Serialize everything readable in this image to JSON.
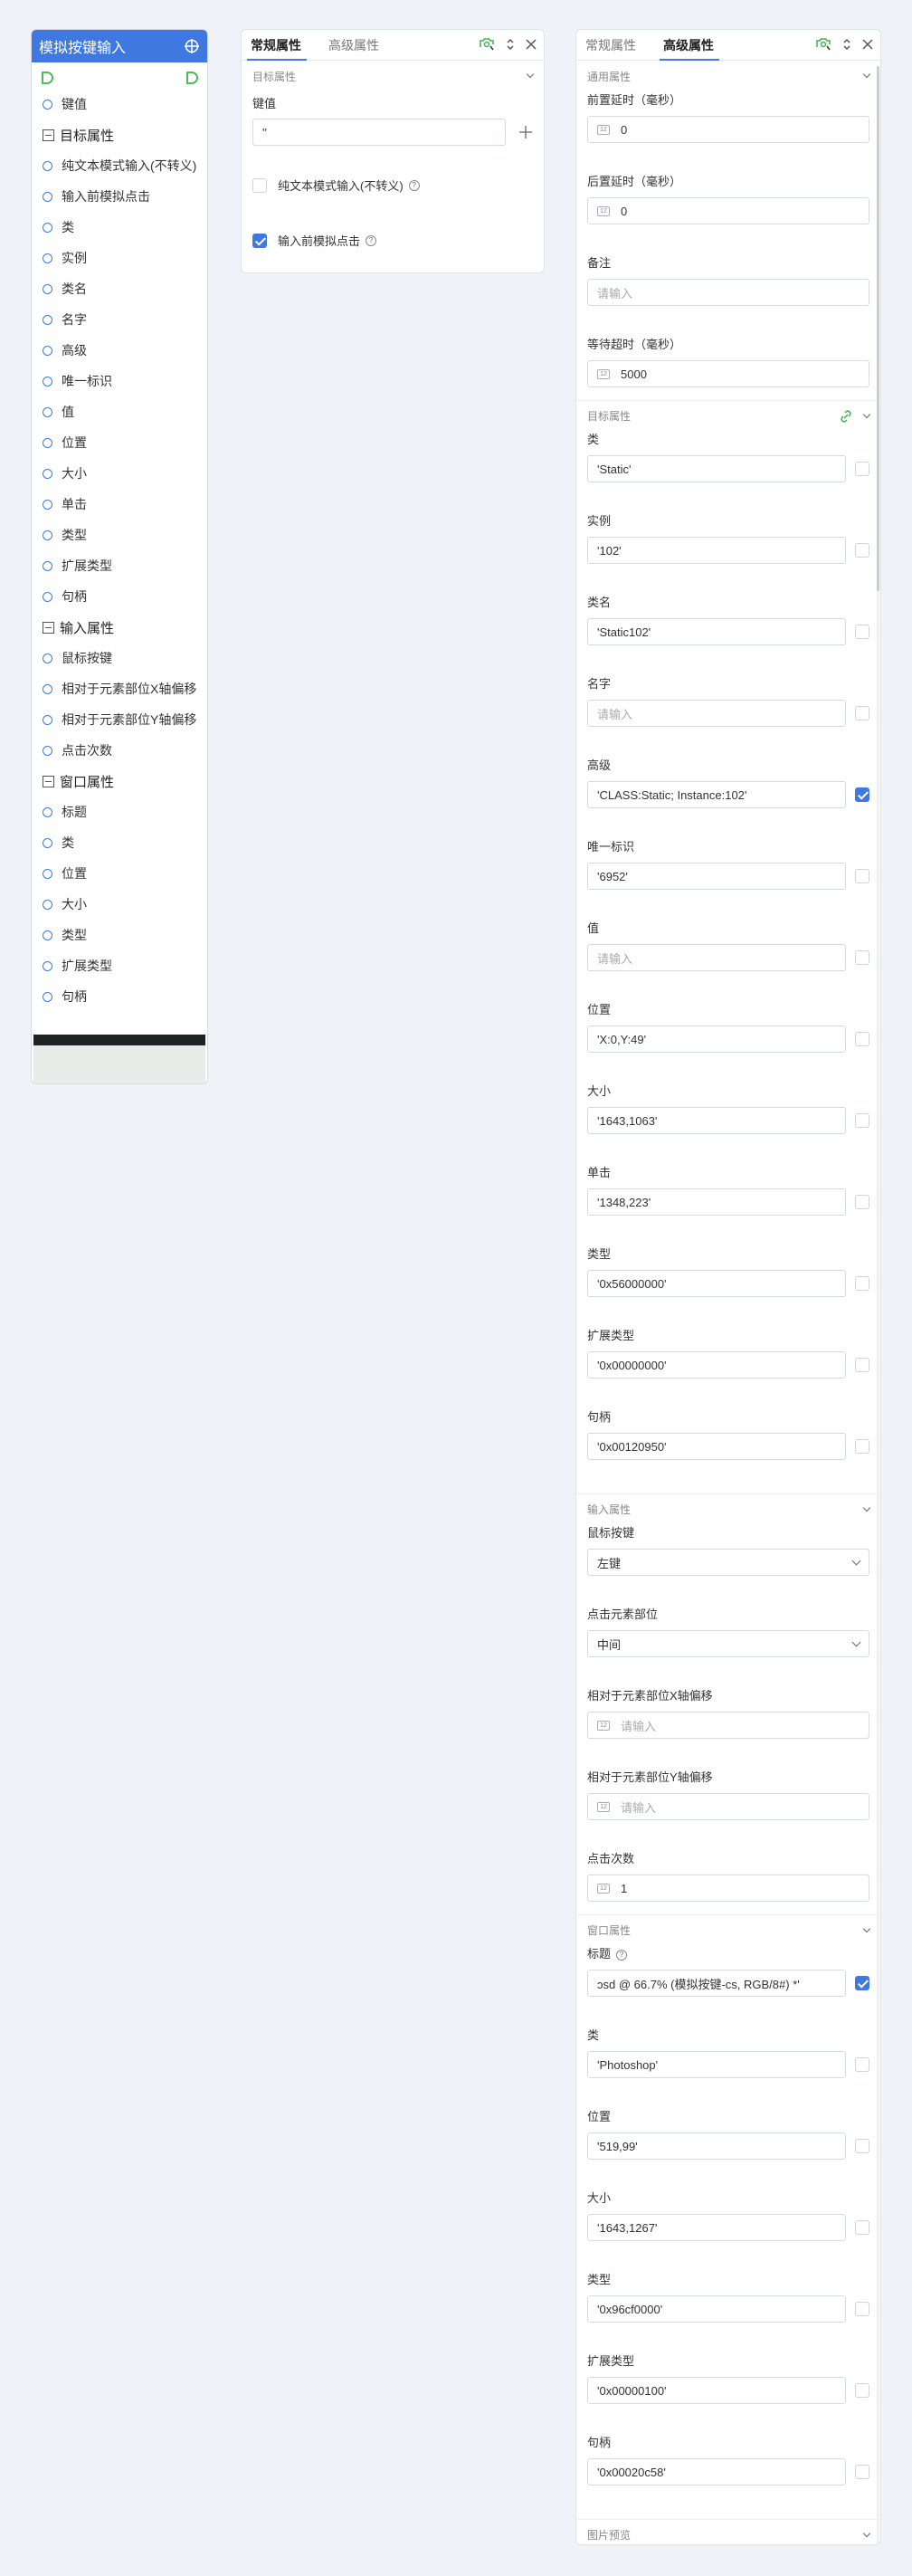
{
  "node": {
    "title": "模拟按键输入",
    "rows": [
      {
        "t": "item",
        "label": "键值"
      },
      {
        "t": "group",
        "label": "目标属性"
      },
      {
        "t": "item",
        "label": "纯文本模式输入(不转义)"
      },
      {
        "t": "item",
        "label": "输入前模拟点击"
      },
      {
        "t": "item",
        "label": "类"
      },
      {
        "t": "item",
        "label": "实例"
      },
      {
        "t": "item",
        "label": "类名"
      },
      {
        "t": "item",
        "label": "名字"
      },
      {
        "t": "item",
        "label": "高级"
      },
      {
        "t": "item",
        "label": "唯一标识"
      },
      {
        "t": "item",
        "label": "值"
      },
      {
        "t": "item",
        "label": "位置"
      },
      {
        "t": "item",
        "label": "大小"
      },
      {
        "t": "item",
        "label": "单击"
      },
      {
        "t": "item",
        "label": "类型"
      },
      {
        "t": "item",
        "label": "扩展类型"
      },
      {
        "t": "item",
        "label": "句柄"
      },
      {
        "t": "group",
        "label": "输入属性"
      },
      {
        "t": "item",
        "label": "鼠标按键"
      },
      {
        "t": "item",
        "label": "相对于元素部位X轴偏移"
      },
      {
        "t": "item",
        "label": "相对于元素部位Y轴偏移"
      },
      {
        "t": "item",
        "label": "点击次数"
      },
      {
        "t": "group",
        "label": "窗口属性"
      },
      {
        "t": "item",
        "label": "标题"
      },
      {
        "t": "item",
        "label": "类"
      },
      {
        "t": "item",
        "label": "位置"
      },
      {
        "t": "item",
        "label": "大小"
      },
      {
        "t": "item",
        "label": "类型"
      },
      {
        "t": "item",
        "label": "扩展类型"
      },
      {
        "t": "item",
        "label": "句柄"
      }
    ]
  },
  "p1": {
    "tab_general": "常规属性",
    "tab_advanced": "高级属性",
    "section": "目标属性",
    "key_label": "键值",
    "key_value": "''",
    "plain_text": "纯文本模式输入(不转义)",
    "pre_click": "输入前模拟点击"
  },
  "p2": {
    "tab_general": "常规属性",
    "tab_advanced": "高级属性",
    "common_section": "通用属性",
    "pre_delay_label": "前置延时（毫秒）",
    "pre_delay": "0",
    "post_delay_label": "后置延时（毫秒）",
    "post_delay": "0",
    "note_label": "备注",
    "placeholder": "请输入",
    "timeout_label": "等待超时（毫秒）",
    "timeout": "5000",
    "target_section": "目标属性",
    "targets": [
      {
        "label": "类",
        "value": "'Static'",
        "checked": false
      },
      {
        "label": "实例",
        "value": "'102'",
        "checked": false
      },
      {
        "label": "类名",
        "value": "'Static102'",
        "checked": false
      },
      {
        "label": "名字",
        "value": "",
        "checked": false
      },
      {
        "label": "高级",
        "value": "'CLASS:Static; Instance:102'",
        "checked": true
      },
      {
        "label": "唯一标识",
        "value": "'6952'",
        "checked": false
      },
      {
        "label": "值",
        "value": "",
        "checked": false
      },
      {
        "label": "位置",
        "value": "'X:0,Y:49'",
        "checked": false
      },
      {
        "label": "大小",
        "value": "'1643,1063'",
        "checked": false
      },
      {
        "label": "单击",
        "value": "'1348,223'",
        "checked": false
      },
      {
        "label": "类型",
        "value": "'0x56000000'",
        "checked": false
      },
      {
        "label": "扩展类型",
        "value": "'0x00000000'",
        "checked": false
      },
      {
        "label": "句柄",
        "value": "'0x00120950'",
        "checked": false
      }
    ],
    "input_section": "输入属性",
    "mouse_label": "鼠标按键",
    "mouse_value": "左键",
    "click_part_label": "点击元素部位",
    "click_part_value": "中间",
    "x_offset_label": "相对于元素部位X轴偏移",
    "y_offset_label": "相对于元素部位Y轴偏移",
    "click_count_label": "点击次数",
    "click_count": "1",
    "window_section": "窗口属性",
    "window_title_label": "标题",
    "window_title_value": "ɔsd @ 66.7% (模拟按键-cs, RGB/8#) *'",
    "windows": [
      {
        "label": "类",
        "value": "'Photoshop'",
        "checked": false
      },
      {
        "label": "位置",
        "value": "'519,99'",
        "checked": false
      },
      {
        "label": "大小",
        "value": "'1643,1267'",
        "checked": false
      },
      {
        "label": "类型",
        "value": "'0x96cf0000'",
        "checked": false
      },
      {
        "label": "扩展类型",
        "value": "'0x00000100'",
        "checked": false
      },
      {
        "label": "句柄",
        "value": "'0x00020c58'",
        "checked": false
      }
    ],
    "preview_section": "图片预览"
  }
}
